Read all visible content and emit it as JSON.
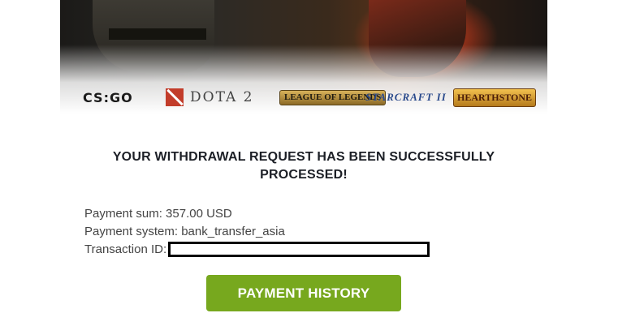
{
  "logos": {
    "csgo": "CS:GO",
    "dota": "DOTA 2",
    "lol": "LEAGUE OF LEGENDS",
    "starcraft": "STARCRAFT II",
    "hearthstone": "HEARTHSTONE"
  },
  "message": {
    "headline": "YOUR WITHDRAWAL REQUEST HAS BEEN SUCCESSFULLY PROCESSED!"
  },
  "details": {
    "payment_sum_label": "Payment sum:",
    "payment_sum_value": "357.00 USD",
    "payment_system_label": "Payment system:",
    "payment_system_value": "bank_transfer_asia",
    "transaction_id_label": "Transaction ID:"
  },
  "button": {
    "label": "PAYMENT HISTORY",
    "color": "#77a81e"
  },
  "colors": {
    "headline": "#1c1f26",
    "body_text": "#444444"
  }
}
